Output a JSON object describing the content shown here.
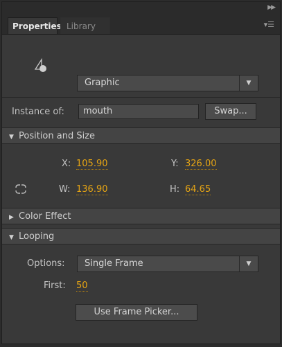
{
  "tabs": {
    "properties": "Properties",
    "library": "Library"
  },
  "symbol": {
    "type_selected": "Graphic"
  },
  "instance": {
    "label": "Instance of:",
    "name": "mouth",
    "swap_label": "Swap..."
  },
  "position_size": {
    "header": "Position and Size",
    "x_label": "X:",
    "x_value": "105.90",
    "y_label": "Y:",
    "y_value": "326.00",
    "w_label": "W:",
    "w_value": "136.90",
    "h_label": "H:",
    "h_value": "64.65"
  },
  "color_effect": {
    "header": "Color Effect"
  },
  "looping": {
    "header": "Looping",
    "options_label": "Options:",
    "options_selected": "Single Frame",
    "first_label": "First:",
    "first_value": "50",
    "frame_picker_label": "Use Frame Picker..."
  },
  "colors": {
    "panel_bg": "#393939",
    "value_accent": "#e5a414"
  }
}
